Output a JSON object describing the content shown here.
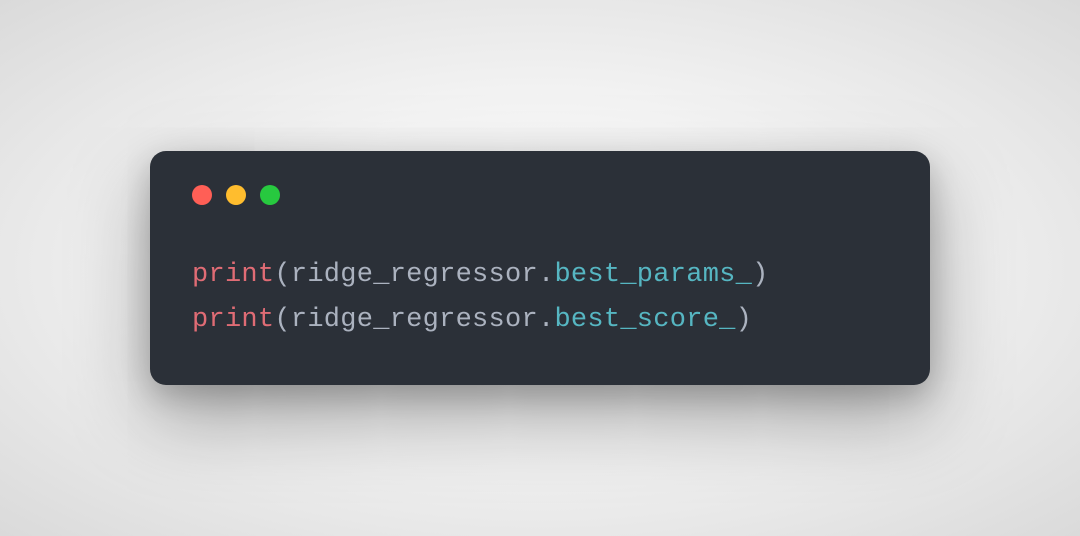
{
  "window": {
    "buttons": {
      "close": "close",
      "minimize": "minimize",
      "zoom": "zoom"
    }
  },
  "code": {
    "lines": [
      {
        "fn": "print",
        "open": "(",
        "var": "ridge_regressor",
        "dot": ".",
        "prop": "best_params_",
        "close": ")"
      },
      {
        "fn": "print",
        "open": "(",
        "var": "ridge_regressor",
        "dot": ".",
        "prop": "best_score_",
        "close": ")"
      }
    ]
  },
  "colors": {
    "bg": "#2b3038",
    "fn": "#e06c75",
    "default": "#abb2bf",
    "prop": "#56b6c2",
    "red": "#ff5f56",
    "yellow": "#ffbd2e",
    "green": "#27c93f"
  }
}
